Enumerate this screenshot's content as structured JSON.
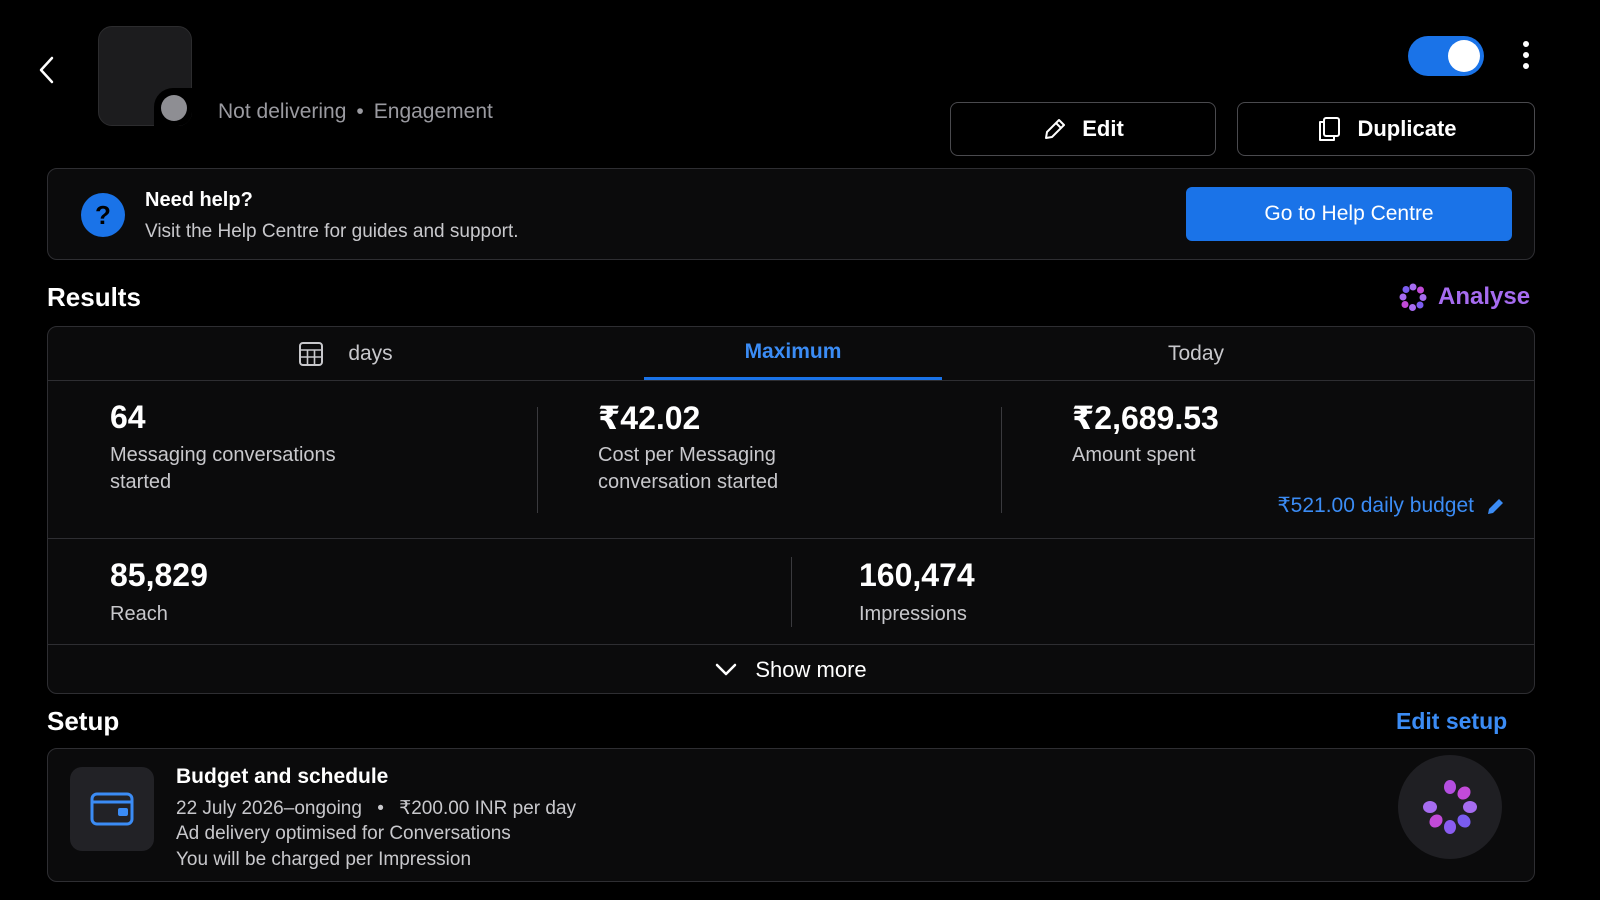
{
  "header": {
    "status": "Not delivering",
    "separator": "•",
    "objective": "Engagement",
    "edit_label": "Edit",
    "duplicate_label": "Duplicate",
    "toggle_on": true
  },
  "help": {
    "icon": "?",
    "title": "Need help?",
    "description": "Visit the Help Centre for guides and support.",
    "button": "Go to Help Centre"
  },
  "results": {
    "title": "Results",
    "analyse": "Analyse",
    "tabs": [
      {
        "label": "days",
        "icon": "calendar-icon"
      },
      {
        "label": "Maximum",
        "active": true
      },
      {
        "label": "Today"
      }
    ],
    "metrics": [
      {
        "value": "64",
        "label": "Messaging conversations started"
      },
      {
        "value": "₹42.02",
        "label": "Cost per Messaging conversation started"
      },
      {
        "value": "₹2,689.53",
        "label": "Amount spent"
      },
      {
        "value": "85,829",
        "label": "Reach"
      },
      {
        "value": "160,474",
        "label": "Impressions"
      }
    ],
    "daily_budget": "₹521.00 daily budget",
    "show_more": "Show more"
  },
  "setup": {
    "title": "Setup",
    "edit": "Edit setup",
    "budget": {
      "title": "Budget and schedule",
      "schedule": "22 July 2026–ongoing",
      "separator": "•",
      "amount": "₹200.00 INR per day",
      "optimisation": "Ad delivery optimised for Conversations",
      "charge": "You will be charged per Impression"
    }
  },
  "colors": {
    "accent": "#1a73e8",
    "link": "#3b8cf5",
    "ai": "#a66cf0",
    "background": "#000000"
  }
}
